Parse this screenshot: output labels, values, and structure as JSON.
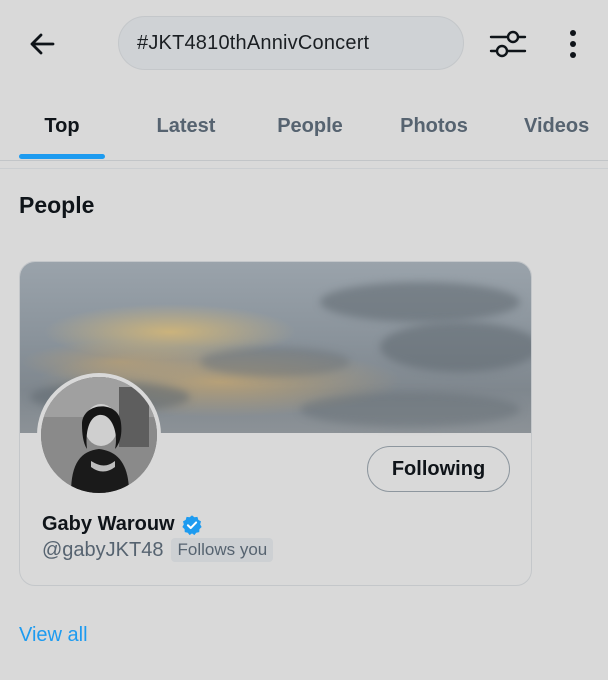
{
  "header": {
    "search_query": "#JKT4810thAnnivConcert"
  },
  "tabs": [
    {
      "label": "Top"
    },
    {
      "label": "Latest"
    },
    {
      "label": "People"
    },
    {
      "label": "Photos"
    },
    {
      "label": "Videos"
    }
  ],
  "section": {
    "title": "People"
  },
  "user_card": {
    "display_name": "Gaby Warouw",
    "handle": "@gabyJKT48",
    "follows_badge": "Follows you",
    "follow_button": "Following"
  },
  "view_all_label": "View all",
  "icons": {
    "back": "arrow-left-icon",
    "filter": "sliders-icon",
    "more": "more-vertical-icon",
    "verified": "verified-badge-icon"
  },
  "colors": {
    "accent": "#1d9bf0",
    "background": "#d9d9d9",
    "text_primary": "#0f1419",
    "text_secondary": "#566370"
  }
}
